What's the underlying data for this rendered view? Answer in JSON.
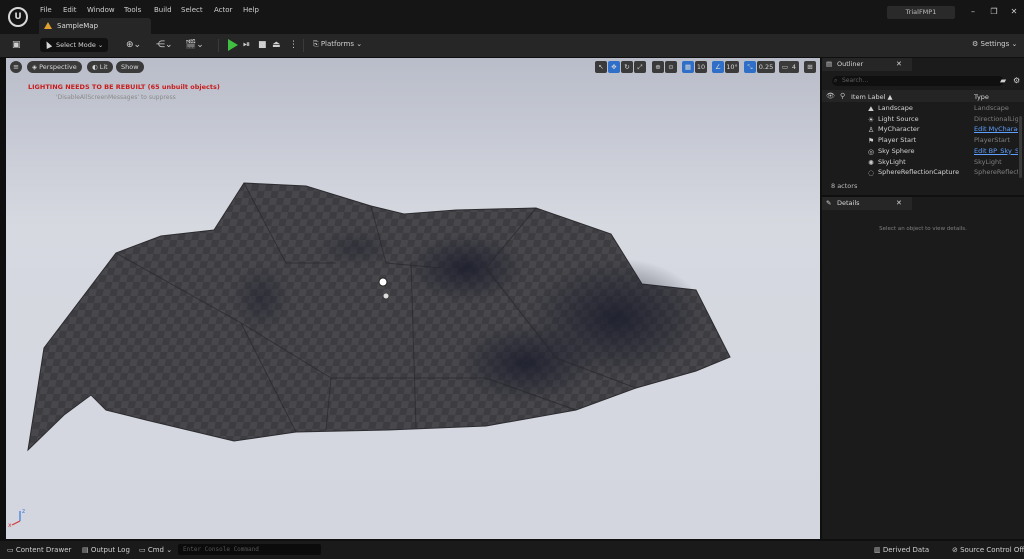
{
  "menu": {
    "items": [
      "File",
      "Edit",
      "Window",
      "Tools",
      "Build",
      "Select",
      "Actor",
      "Help"
    ]
  },
  "tab": {
    "label": "SampleMap"
  },
  "project_name": "TrialFMP1",
  "toolbar": {
    "select_mode": "Select Mode",
    "platforms": "Platforms",
    "settings": "Settings"
  },
  "viewport": {
    "perspective": "Perspective",
    "lit": "Lit",
    "show": "Show",
    "grid_snap": "10",
    "rotation_snap": "10°",
    "scale_snap": "0.25",
    "camera_speed": "4",
    "lighting_warning": "LIGHTING NEEDS TO BE REBUILT (65 unbuilt objects)",
    "suppress_msg": "'DisableAllScreenMessages' to suppress",
    "sky_color": "#ccd0dc",
    "landscape_color": "#3c3c40"
  },
  "outliner": {
    "tab_label": "Outliner",
    "search_placeholder": "Search...",
    "col_label": "Item Label ▲",
    "col_type": "Type",
    "rows": [
      {
        "label": "Landscape",
        "type": "Landscape",
        "link": false,
        "icon": "⛰"
      },
      {
        "label": "Light Source",
        "type": "DirectionalLigh",
        "link": false,
        "icon": "☀"
      },
      {
        "label": "MyCharacter",
        "type": "Edit MyCharac",
        "link": true,
        "icon": "♙"
      },
      {
        "label": "Player Start",
        "type": "PlayerStart",
        "link": false,
        "icon": "⚑"
      },
      {
        "label": "Sky Sphere",
        "type": "Edit BP_Sky_S",
        "link": true,
        "icon": "◎"
      },
      {
        "label": "SkyLight",
        "type": "SkyLight",
        "link": false,
        "icon": "✺"
      },
      {
        "label": "SphereReflectionCapture",
        "type": "SphereReflecti",
        "link": false,
        "icon": "◌"
      }
    ],
    "actor_count": "8 actors"
  },
  "details": {
    "tab_label": "Details",
    "empty_msg": "Select an object to view details."
  },
  "statusbar": {
    "content_drawer": "Content Drawer",
    "output_log": "Output Log",
    "cmd": "Cmd",
    "console_placeholder": "Enter Console Command",
    "derived_data": "Derived Data",
    "source_control": "Source Control Off"
  }
}
